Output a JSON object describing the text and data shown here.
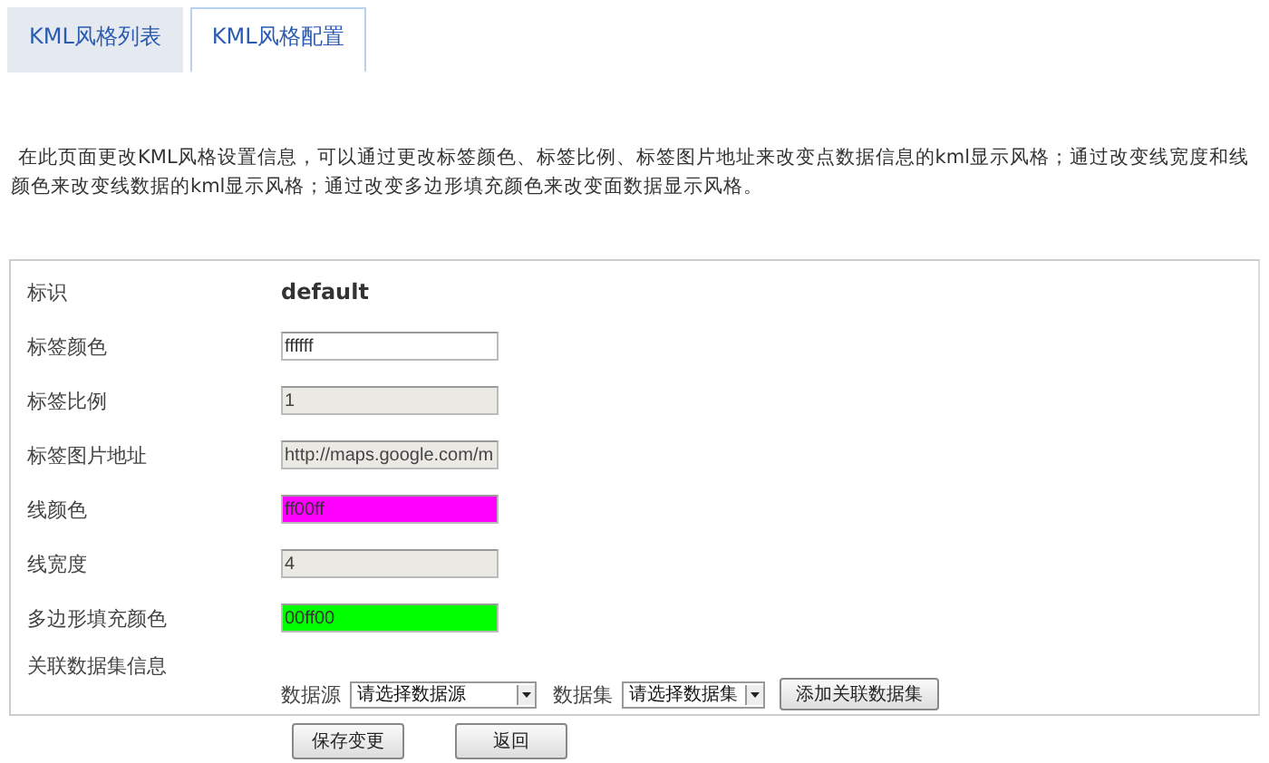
{
  "tabs": [
    {
      "label": "KML风格列表",
      "selected": false
    },
    {
      "label": "KML风格配置",
      "selected": true
    }
  ],
  "description": "在此页面更改KML风格设置信息，可以通过更改标签颜色、标签比例、标签图片地址来改变点数据信息的kml显示风格；通过改变线宽度和线颜色来改变线数据的kml显示风格；通过改变多边形填充颜色来改变面数据显示风格。",
  "form": {
    "rows": [
      {
        "kind": "text",
        "label": "标识",
        "value": "default"
      },
      {
        "kind": "input",
        "label": "标签颜色",
        "value": "ffffff",
        "disabled": false
      },
      {
        "kind": "input",
        "label": "标签比例",
        "value": "1",
        "disabled": true
      },
      {
        "kind": "input",
        "label": "标签图片地址",
        "value": "http://maps.google.com/m",
        "disabled": true
      },
      {
        "kind": "input",
        "label": "线颜色",
        "value": "ff00ff",
        "disabled": false,
        "color": "#ff00ff"
      },
      {
        "kind": "input",
        "label": "线宽度",
        "value": "4",
        "disabled": true
      },
      {
        "kind": "input",
        "label": "多边形填充颜色",
        "value": "00ff00",
        "disabled": false,
        "color": "#00ff00"
      },
      {
        "kind": "dataset",
        "label": "关联数据集信息",
        "source_label": "数据源",
        "source_value": "请选择数据源",
        "set_label": "数据集",
        "set_value": "请选择数据集",
        "add_button": "添加关联数据集"
      }
    ]
  },
  "buttons": [
    "保存变更",
    "返回"
  ]
}
